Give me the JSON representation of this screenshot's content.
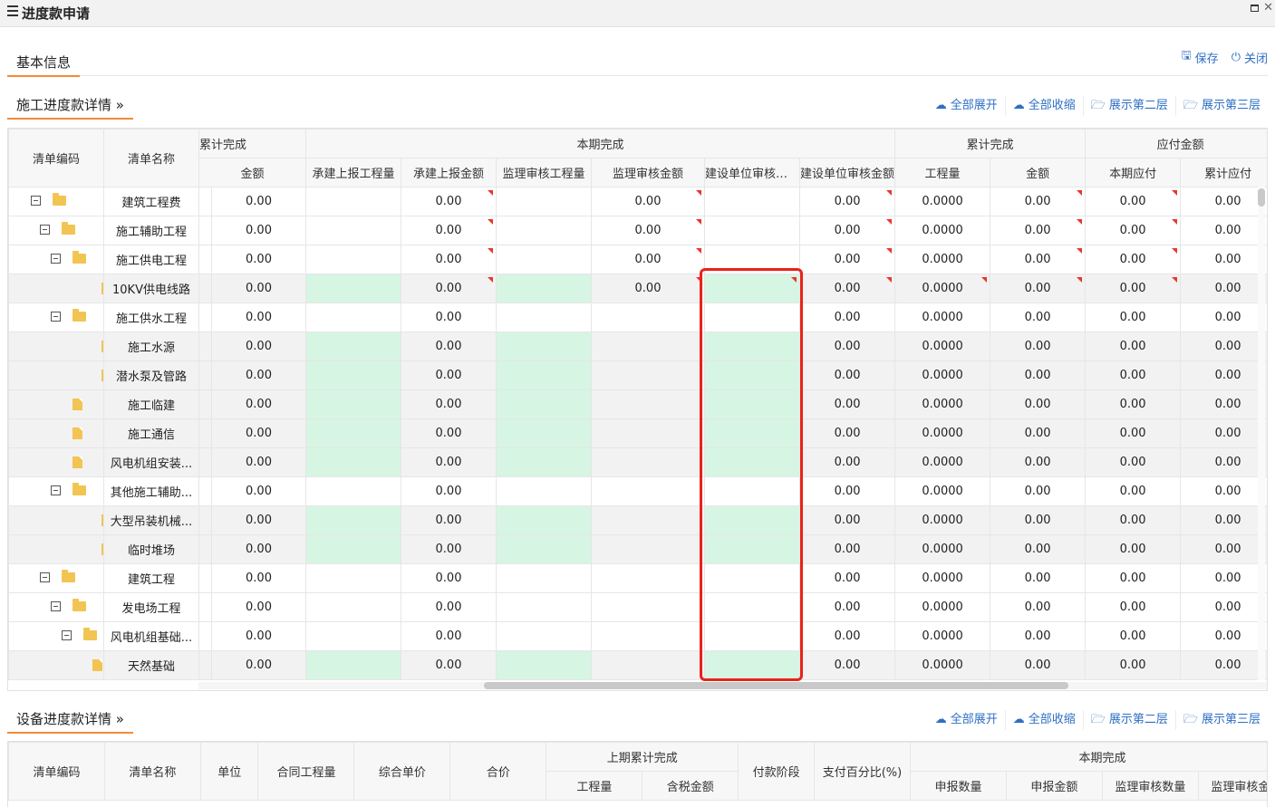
{
  "window": {
    "title": "进度款申请"
  },
  "tabs": {
    "basic": "基本信息",
    "save": "保存",
    "close": "关闭"
  },
  "section1": {
    "title": "施工进度款详情",
    "buttons": [
      "全部展开",
      "全部收缩",
      "展示第二层",
      "展示第三层"
    ],
    "headers": {
      "code": "清单编码",
      "name": "清单名称",
      "prev_group": "累计完成",
      "prev_amount": "金额",
      "current_group": "本期完成",
      "current_cols": [
        "承建上报工程量",
        "承建上报金额",
        "监理审核工程量",
        "监理审核金额",
        "建设单位审核工程量",
        "建设单位审核金额"
      ],
      "cum_group": "累计完成",
      "cum_cols": [
        "工程量",
        "金额"
      ],
      "pay_group": "应付金额",
      "pay_cols": [
        "本期应付",
        "累计应付"
      ]
    },
    "rows": [
      {
        "name": "建筑工程费",
        "level": 0,
        "folder": true,
        "prev": "0.00",
        "c1": "",
        "c2": "0.00",
        "c3": "",
        "c4": "0.00",
        "c5": "",
        "c6": "0.00",
        "q": "0.0000",
        "a": "0.00",
        "p1": "0.00",
        "p2": "0.00"
      },
      {
        "name": "施工辅助工程",
        "level": 1,
        "folder": true,
        "prev": "0.00",
        "c1": "",
        "c2": "0.00",
        "c3": "",
        "c4": "0.00",
        "c5": "",
        "c6": "0.00",
        "q": "0.0000",
        "a": "0.00",
        "p1": "0.00",
        "p2": "0.00"
      },
      {
        "name": "施工供电工程",
        "level": 2,
        "folder": true,
        "prev": "0.00",
        "c1": "",
        "c2": "0.00",
        "c3": "",
        "c4": "0.00",
        "c5": "",
        "c6": "0.00",
        "q": "0.0000",
        "a": "0.00",
        "p1": "0.00",
        "p2": "0.00"
      },
      {
        "name": "10KV供电线路",
        "level": 3,
        "folder": false,
        "prev": "0.00",
        "c1": "",
        "c2": "0.00",
        "c3": "",
        "c4": "0.00",
        "c5": "",
        "c6": "0.00",
        "q": "0.0000",
        "a": "0.00",
        "p1": "0.00",
        "p2": "0.00"
      },
      {
        "name": "施工供水工程",
        "level": 2,
        "folder": true,
        "prev": "0.00",
        "c1": "",
        "c2": "0.00",
        "c3": "",
        "c4": "",
        "c5": "",
        "c6": "0.00",
        "q": "0.0000",
        "a": "0.00",
        "p1": "0.00",
        "p2": "0.00"
      },
      {
        "name": "施工水源",
        "level": 3,
        "folder": false,
        "prev": "0.00",
        "c1": "",
        "c2": "0.00",
        "c3": "",
        "c4": "",
        "c5": "",
        "c6": "0.00",
        "q": "0.0000",
        "a": "0.00",
        "p1": "0.00",
        "p2": "0.00"
      },
      {
        "name": "潜水泵及管路",
        "level": 3,
        "folder": false,
        "prev": "0.00",
        "c1": "",
        "c2": "0.00",
        "c3": "",
        "c4": "",
        "c5": "",
        "c6": "0.00",
        "q": "0.0000",
        "a": "0.00",
        "p1": "0.00",
        "p2": "0.00"
      },
      {
        "name": "施工临建",
        "level": 2,
        "folder": false,
        "prev": "0.00",
        "c1": "",
        "c2": "0.00",
        "c3": "",
        "c4": "",
        "c5": "",
        "c6": "0.00",
        "q": "0.0000",
        "a": "0.00",
        "p1": "0.00",
        "p2": "0.00"
      },
      {
        "name": "施工通信",
        "level": 2,
        "folder": false,
        "prev": "0.00",
        "c1": "",
        "c2": "0.00",
        "c3": "",
        "c4": "",
        "c5": "",
        "c6": "0.00",
        "q": "0.0000",
        "a": "0.00",
        "p1": "0.00",
        "p2": "0.00"
      },
      {
        "name": "风电机组安装...",
        "level": 2,
        "folder": false,
        "prev": "0.00",
        "c1": "",
        "c2": "0.00",
        "c3": "",
        "c4": "",
        "c5": "",
        "c6": "0.00",
        "q": "0.0000",
        "a": "0.00",
        "p1": "0.00",
        "p2": "0.00"
      },
      {
        "name": "其他施工辅助...",
        "level": 2,
        "folder": true,
        "prev": "0.00",
        "c1": "",
        "c2": "0.00",
        "c3": "",
        "c4": "",
        "c5": "",
        "c6": "0.00",
        "q": "0.0000",
        "a": "0.00",
        "p1": "0.00",
        "p2": "0.00"
      },
      {
        "name": "大型吊装机械...",
        "level": 3,
        "folder": false,
        "prev": "0.00",
        "c1": "",
        "c2": "0.00",
        "c3": "",
        "c4": "",
        "c5": "",
        "c6": "0.00",
        "q": "0.0000",
        "a": "0.00",
        "p1": "0.00",
        "p2": "0.00"
      },
      {
        "name": "临时堆场",
        "level": 3,
        "folder": false,
        "prev": "0.00",
        "c1": "",
        "c2": "0.00",
        "c3": "",
        "c4": "",
        "c5": "",
        "c6": "0.00",
        "q": "0.0000",
        "a": "0.00",
        "p1": "0.00",
        "p2": "0.00"
      },
      {
        "name": "建筑工程",
        "level": 1,
        "folder": true,
        "prev": "0.00",
        "c1": "",
        "c2": "0.00",
        "c3": "",
        "c4": "",
        "c5": "",
        "c6": "0.00",
        "q": "0.0000",
        "a": "0.00",
        "p1": "0.00",
        "p2": "0.00"
      },
      {
        "name": "发电场工程",
        "level": 2,
        "folder": true,
        "prev": "0.00",
        "c1": "",
        "c2": "0.00",
        "c3": "",
        "c4": "",
        "c5": "",
        "c6": "0.00",
        "q": "0.0000",
        "a": "0.00",
        "p1": "0.00",
        "p2": "0.00"
      },
      {
        "name": "风电机组基础...",
        "level": 3,
        "folder": true,
        "prev": "0.00",
        "c1": "",
        "c2": "0.00",
        "c3": "",
        "c4": "",
        "c5": "",
        "c6": "0.00",
        "q": "0.0000",
        "a": "0.00",
        "p1": "0.00",
        "p2": "0.00"
      },
      {
        "name": "天然基础",
        "level": 4,
        "folder": false,
        "prev": "0.00",
        "c1": "",
        "c2": "0.00",
        "c3": "",
        "c4": "",
        "c5": "",
        "c6": "0.00",
        "q": "0.0000",
        "a": "0.00",
        "p1": "0.00",
        "p2": "0.00"
      }
    ]
  },
  "section2": {
    "title": "设备进度款详情",
    "buttons": [
      "全部展开",
      "全部收缩",
      "展示第二层",
      "展示第三层"
    ],
    "headers": {
      "code": "清单编码",
      "name": "清单名称",
      "unit": "单位",
      "contract_qty": "合同工程量",
      "unit_price": "综合单价",
      "total": "合价",
      "prev_group": "上期累计完成",
      "prev_cols": [
        "工程量",
        "含税金额"
      ],
      "pay_stage": "付款阶段",
      "pay_pct": "支付百分比(%)",
      "current_group": "本期完成",
      "current_cols": [
        "申报数量",
        "申报金额",
        "监理审核数量",
        "监理审核金额"
      ]
    }
  },
  "colors": {
    "accent": "#f08c36",
    "link": "#2e6fc4",
    "editable": "#d6f5e3",
    "highlight": "#e8231a"
  }
}
